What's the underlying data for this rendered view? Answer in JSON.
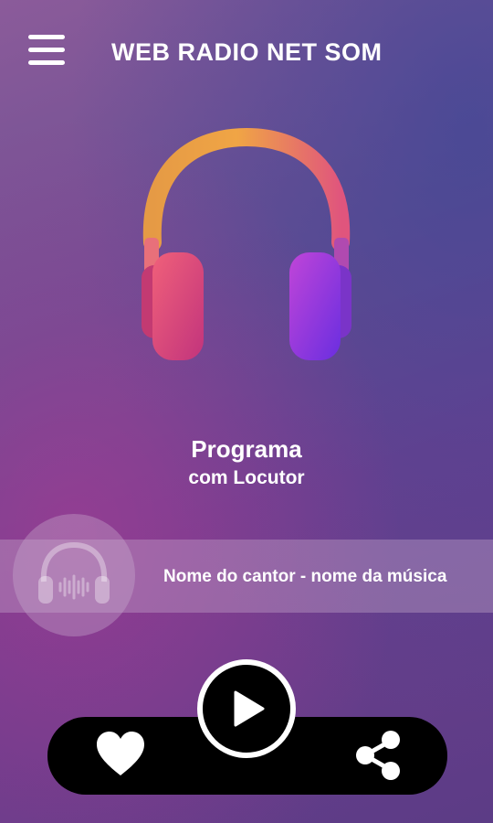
{
  "header": {
    "title": "WEB RADIO NET SOM",
    "menu_icon": "hamburger-menu-icon"
  },
  "hero": {
    "icon": "headphones-icon"
  },
  "program": {
    "name": "Programa",
    "host": "com Locutor"
  },
  "now_playing": {
    "icon": "headphones-waveform-icon",
    "song": "Nome do cantor - nome da música"
  },
  "player": {
    "favorite_icon": "heart-icon",
    "play_icon": "play-icon",
    "share_icon": "share-icon"
  },
  "colors": {
    "headband_start": "#e3a04a",
    "cup_left": "#e7507a",
    "cup_right": "#8b3de6"
  }
}
